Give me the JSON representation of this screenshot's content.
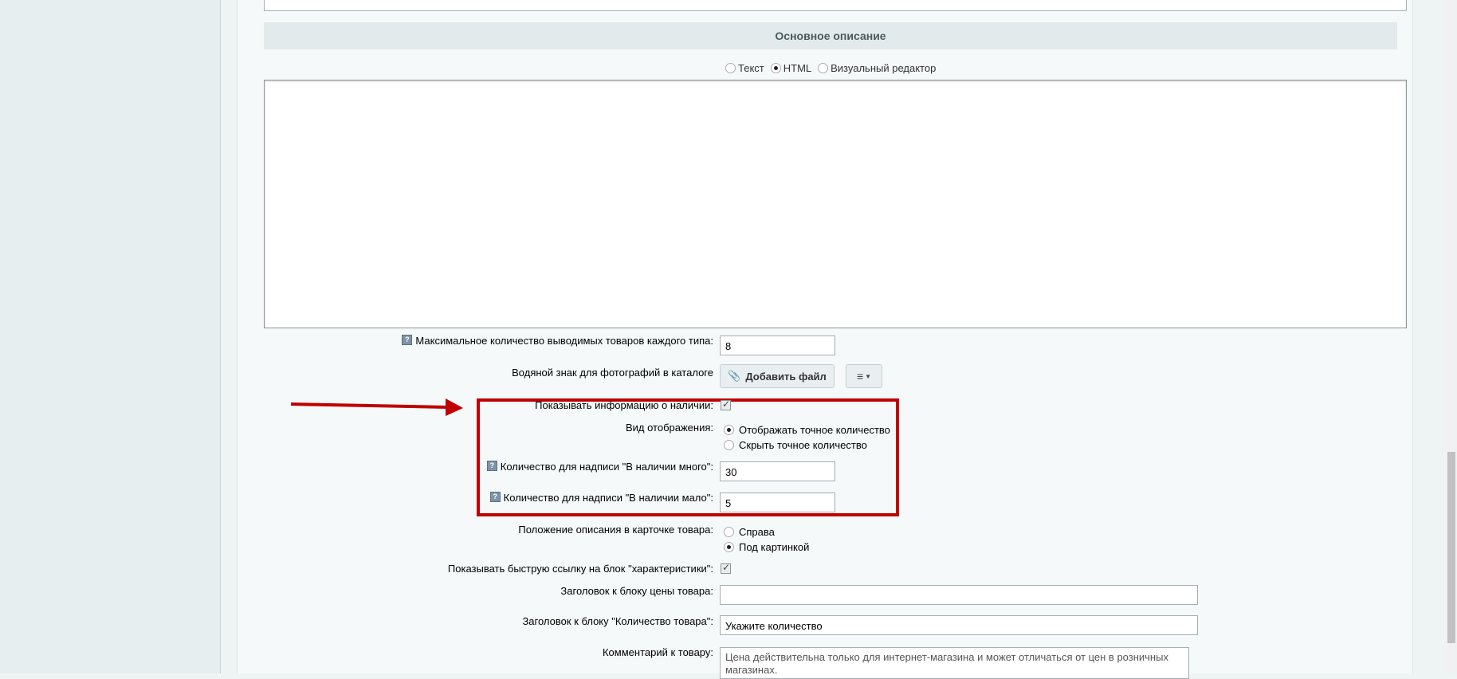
{
  "section": {
    "title": "Основное описание"
  },
  "editor_modes": [
    {
      "label": "Текст",
      "selected": false
    },
    {
      "label": "HTML",
      "selected": true
    },
    {
      "label": "Визуальный редактор",
      "selected": false
    }
  ],
  "fields": {
    "max_items": {
      "label": "Максимальное количество выводимых товаров каждого типа:",
      "value": "8"
    },
    "watermark": {
      "label": "Водяной знак для фотографий в каталоге",
      "button": "Добавить файл"
    },
    "show_availability": {
      "label": "Показывать информацию о наличии:",
      "checked": true
    },
    "display_mode": {
      "label": "Вид отображения:",
      "options": [
        {
          "label": "Отображать точное количество",
          "selected": true
        },
        {
          "label": "Скрыть точное количество",
          "selected": false
        }
      ]
    },
    "qty_many": {
      "label": "Количество для надписи \"В наличии много\":",
      "value": "30"
    },
    "qty_few": {
      "label": "Количество для надписи \"В наличии мало\":",
      "value": "5"
    },
    "desc_position": {
      "label": "Положение описания в карточке товара:",
      "options": [
        {
          "label": "Справа",
          "selected": false
        },
        {
          "label": "Под картинкой",
          "selected": true
        }
      ]
    },
    "quick_link": {
      "label": "Показывать быструю ссылку на блок \"характеристики\":",
      "checked": true
    },
    "price_header": {
      "label": "Заголовок к блоку цены товара:",
      "value": ""
    },
    "qty_header": {
      "label": "Заголовок к блоку \"Количество товара\":",
      "value": "Укажите количество"
    },
    "comment": {
      "label": "Комментарий к товару:",
      "value": "Цена действительна только для интернет-магазина и может отличаться от цен в розничных магазинах."
    }
  },
  "colors": {
    "highlight": "#c00000",
    "header_bg": "#e2eaec"
  }
}
